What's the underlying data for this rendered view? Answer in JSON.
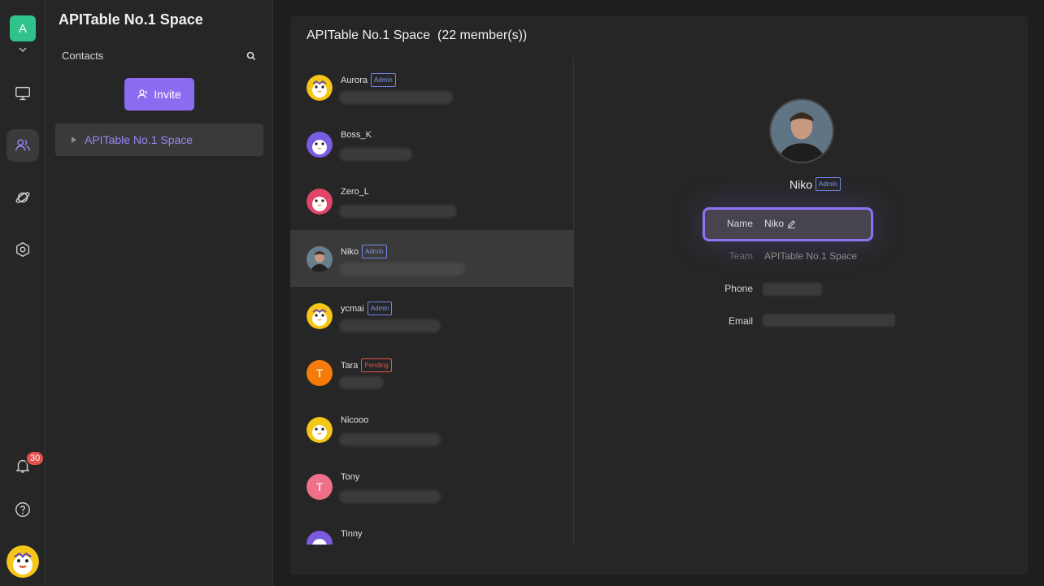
{
  "rail": {
    "space_initial": "A",
    "notification_count": "30"
  },
  "contacts_panel": {
    "title": "APITable No.1 Space",
    "contacts_label": "Contacts",
    "invite_label": "Invite",
    "tree_item": "APITable No.1 Space"
  },
  "main": {
    "title": "APITable No.1 Space  (22 member(s))",
    "members": [
      {
        "name": "Aurora",
        "tag": "Admin",
        "avatar": "mascot-yellow"
      },
      {
        "name": "Boss_K",
        "tag": "",
        "avatar": "mascot-purple"
      },
      {
        "name": "Zero_L",
        "tag": "",
        "avatar": "mascot-pink"
      },
      {
        "name": "Niko",
        "tag": "Admin",
        "avatar": "photo"
      },
      {
        "name": "ycmai",
        "tag": "Admin",
        "avatar": "mascot-yellow"
      },
      {
        "name": "Tara",
        "tag": "Pending",
        "avatar": "letter",
        "letter": "T",
        "color": "#f57c0a"
      },
      {
        "name": "Nicooo",
        "tag": "",
        "avatar": "mascot-yellow"
      },
      {
        "name": "Tony",
        "tag": "",
        "avatar": "letter",
        "letter": "T",
        "color": "#f0708a"
      },
      {
        "name": "Tinny",
        "tag": "",
        "avatar": "mascot-purple"
      }
    ]
  },
  "detail": {
    "name": "Niko",
    "tag": "Admin",
    "name_label": "Name",
    "name_value": "Niko",
    "team_label": "Team",
    "team_value": "APITable No.1 Space",
    "phone_label": "Phone",
    "email_label": "Email"
  },
  "colors": {
    "accent": "#8b6cf0",
    "space_green": "#30c28b",
    "badge_red": "#e8504a"
  }
}
